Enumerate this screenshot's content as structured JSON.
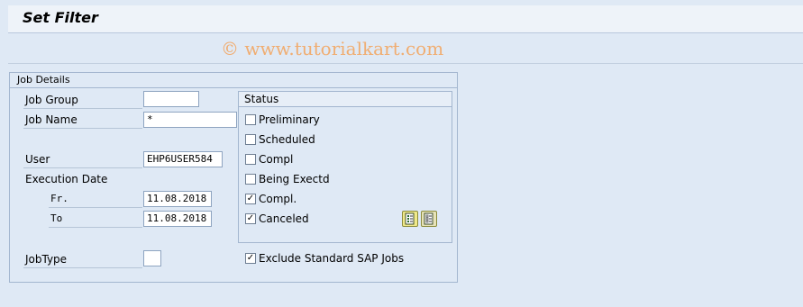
{
  "window": {
    "title": "Set Filter"
  },
  "watermark": "© www.tutorialkart.com",
  "job_details": {
    "group_label": "Job Details",
    "job_group": {
      "label": "Job Group",
      "value": ""
    },
    "job_name": {
      "label": "Job Name",
      "value": "*"
    },
    "user": {
      "label": "User",
      "value": "EHP6USER584"
    },
    "execution_date": {
      "label": "Execution Date",
      "from": {
        "label": "Fr.",
        "value": "11.08.2018"
      },
      "to": {
        "label": "To",
        "value": "11.08.2018"
      }
    },
    "job_type": {
      "label": "JobType",
      "value": ""
    }
  },
  "status": {
    "group_label": "Status",
    "options": [
      {
        "label": "Preliminary",
        "checked": false
      },
      {
        "label": "Scheduled",
        "checked": false
      },
      {
        "label": "Compl",
        "checked": false
      },
      {
        "label": "Being Exectd",
        "checked": false
      },
      {
        "label": "Compl.",
        "checked": true
      },
      {
        "label": "Canceled",
        "checked": true
      }
    ],
    "select_all_icon": "select-all-icon",
    "deselect_all_icon": "deselect-all-icon"
  },
  "exclude_standard": {
    "label": "Exclude Standard SAP Jobs",
    "checked": true
  },
  "colors": {
    "background": "#dfe9f5",
    "watermark": "#f4a35a",
    "border": "#a3b6cf"
  }
}
